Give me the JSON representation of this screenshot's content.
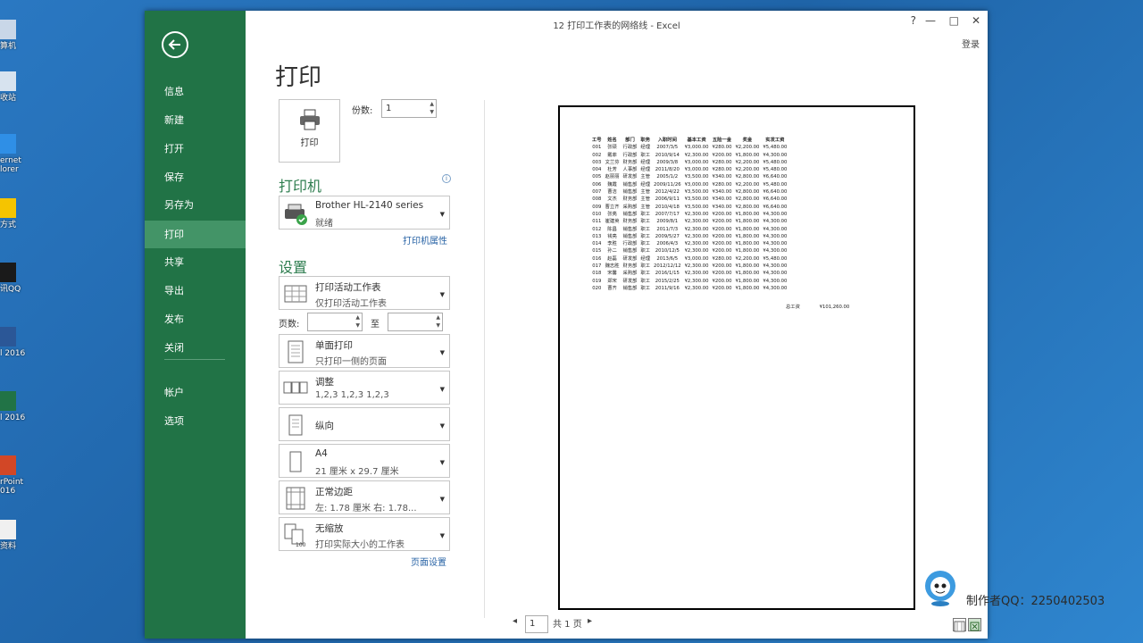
{
  "desktop": {
    "icons": [
      {
        "label": "算机",
        "icon": "computer-icon"
      },
      {
        "label": "收站",
        "icon": "recycle-bin-icon"
      },
      {
        "label": "ernet\nlorer",
        "icon": "internet-explorer-icon"
      },
      {
        "label": "方式",
        "icon": "shortcut-star-icon"
      },
      {
        "label": "讯QQ",
        "icon": "qq-icon"
      },
      {
        "label": "l 2016",
        "icon": "word-icon"
      },
      {
        "label": "l 2016",
        "icon": "excel-icon"
      },
      {
        "label": "rPoint\n016",
        "icon": "powerpoint-icon"
      },
      {
        "label": "资料",
        "icon": "folder-icon"
      }
    ]
  },
  "window": {
    "title": "12 打印工作表的网络线 - Excel",
    "help": "?",
    "minimize": "—",
    "maximize": "□",
    "close": "✕",
    "signin": "登录"
  },
  "sidebar": {
    "items": [
      {
        "label": "信息"
      },
      {
        "label": "新建"
      },
      {
        "label": "打开"
      },
      {
        "label": "保存"
      },
      {
        "label": "另存为"
      },
      {
        "label": "打印",
        "active": true
      },
      {
        "label": "共享"
      },
      {
        "label": "导出"
      },
      {
        "label": "发布"
      },
      {
        "label": "关闭"
      },
      {
        "label": "帐户"
      },
      {
        "label": "选项"
      }
    ]
  },
  "print": {
    "heading": "打印",
    "print_button": "打印",
    "copies_label": "份数:",
    "copies_value": "1",
    "printer_section": "打印机",
    "printer_name": "Brother HL-2140 series",
    "printer_status": "就绪",
    "printer_properties": "打印机属性",
    "settings_section": "设置",
    "what_to_print": {
      "title": "打印活动工作表",
      "desc": "仅打印活动工作表"
    },
    "pages_label": "页数:",
    "pages_to": "至",
    "sides": {
      "title": "单面打印",
      "desc": "只打印一侧的页面"
    },
    "collate": {
      "title": "调整",
      "desc": "1,2,3    1,2,3    1,2,3"
    },
    "orientation": {
      "title": "纵向"
    },
    "paper": {
      "title": "A4",
      "desc": "21 厘米 x 29.7 厘米"
    },
    "margins": {
      "title": "正常边距",
      "desc": "左: 1.78 厘米    右: 1.78..."
    },
    "scaling": {
      "title": "无缩放",
      "desc": "打印实际大小的工作表"
    },
    "page_setup": "页面设置"
  },
  "preview": {
    "headers": [
      "工号",
      "姓名",
      "部门",
      "职务",
      "入职时间",
      "基本工资",
      "五险一金",
      "奖金",
      "实发工资"
    ],
    "rows": [
      [
        "001",
        "张硕",
        "行政部",
        "经理",
        "2007/3/5",
        "¥3,000.00",
        "¥280.00",
        "¥2,200.00",
        "¥5,480.00"
      ],
      [
        "002",
        "戴菲",
        "行政部",
        "职工",
        "2010/9/14",
        "¥2,300.00",
        "¥200.00",
        "¥1,800.00",
        "¥4,300.00"
      ],
      [
        "003",
        "文兰芬",
        "财务部",
        "经理",
        "2009/3/8",
        "¥3,000.00",
        "¥280.00",
        "¥2,200.00",
        "¥5,480.00"
      ],
      [
        "004",
        "杜芳",
        "人事部",
        "经理",
        "2011/8/20",
        "¥3,000.00",
        "¥280.00",
        "¥2,200.00",
        "¥5,480.00"
      ],
      [
        "005",
        "赵丽丽",
        "研发部",
        "主管",
        "2005/1/2",
        "¥3,500.00",
        "¥340.00",
        "¥2,800.00",
        "¥6,640.00"
      ],
      [
        "006",
        "魏霞",
        "销售部",
        "经理",
        "2009/11/26",
        "¥3,000.00",
        "¥280.00",
        "¥2,200.00",
        "¥5,480.00"
      ],
      [
        "007",
        "曹洁",
        "销售部",
        "主管",
        "2012/4/22",
        "¥3,500.00",
        "¥340.00",
        "¥2,800.00",
        "¥6,640.00"
      ],
      [
        "008",
        "文杰",
        "财务部",
        "主管",
        "2006/9/11",
        "¥3,500.00",
        "¥340.00",
        "¥2,800.00",
        "¥6,640.00"
      ],
      [
        "009",
        "曹立齐",
        "采购部",
        "主管",
        "2010/4/18",
        "¥3,500.00",
        "¥340.00",
        "¥2,800.00",
        "¥6,640.00"
      ],
      [
        "010",
        "张亮",
        "销售部",
        "职工",
        "2007/7/17",
        "¥2,300.00",
        "¥200.00",
        "¥1,800.00",
        "¥4,300.00"
      ],
      [
        "011",
        "崔建英",
        "财务部",
        "职工",
        "2009/8/1",
        "¥2,300.00",
        "¥200.00",
        "¥1,800.00",
        "¥4,300.00"
      ],
      [
        "012",
        "陈昌",
        "销售部",
        "职工",
        "2011/7/3",
        "¥2,300.00",
        "¥200.00",
        "¥1,800.00",
        "¥4,300.00"
      ],
      [
        "013",
        "钱亮",
        "销售部",
        "职工",
        "2009/5/27",
        "¥2,300.00",
        "¥200.00",
        "¥1,800.00",
        "¥4,300.00"
      ],
      [
        "014",
        "李胜",
        "行政部",
        "职工",
        "2006/4/3",
        "¥2,300.00",
        "¥200.00",
        "¥1,800.00",
        "¥4,300.00"
      ],
      [
        "015",
        "孙二",
        "销售部",
        "职工",
        "2010/12/5",
        "¥2,300.00",
        "¥200.00",
        "¥1,800.00",
        "¥4,300.00"
      ],
      [
        "016",
        "赵磊",
        "研发部",
        "经理",
        "2013/6/5",
        "¥3,000.00",
        "¥280.00",
        "¥2,200.00",
        "¥5,480.00"
      ],
      [
        "017",
        "魏志胜",
        "财务部",
        "职工",
        "2012/12/12",
        "¥2,300.00",
        "¥200.00",
        "¥1,800.00",
        "¥4,300.00"
      ],
      [
        "018",
        "宋馨",
        "采购部",
        "职工",
        "2016/1/15",
        "¥2,300.00",
        "¥200.00",
        "¥1,800.00",
        "¥4,300.00"
      ],
      [
        "019",
        "郑宋",
        "研发部",
        "职工",
        "2015/2/25",
        "¥2,300.00",
        "¥200.00",
        "¥1,800.00",
        "¥4,300.00"
      ],
      [
        "020",
        "曹齐",
        "销售部",
        "职工",
        "2011/9/16",
        "¥2,300.00",
        "¥200.00",
        "¥1,800.00",
        "¥4,300.00"
      ]
    ],
    "total_label": "总工资",
    "total_value": "¥101,260.00",
    "current_page": "1",
    "page_count": "共 1 页"
  },
  "watermark": {
    "text": "制作者QQ：2250402503"
  },
  "colors": {
    "sidebar": "#217346",
    "sidebar_active": "#439467",
    "accent_text": "#2e7d4f",
    "link": "#2a64a6"
  }
}
